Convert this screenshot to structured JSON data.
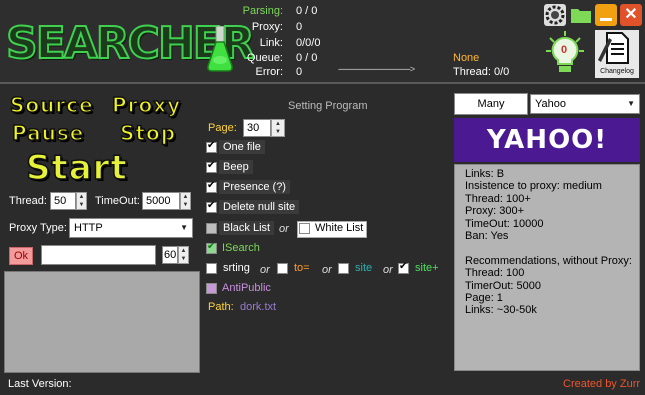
{
  "app": {
    "logo_text": "SEARCHER"
  },
  "status": {
    "parsing": {
      "label": "Parsing:",
      "value": "0 / 0"
    },
    "proxy": {
      "label": "Proxy:",
      "value": "0"
    },
    "link": {
      "label": "Link:",
      "value": "0/0/0"
    },
    "queue": {
      "label": "Queue:",
      "value": "0 / 0"
    },
    "error": {
      "label": "Error:",
      "value": "0"
    },
    "arrow": "------------------------------------>",
    "current": "None",
    "thread_label": "Thread:",
    "thread_value": "0/0"
  },
  "top_buttons": {
    "bulb_count": "0",
    "changelog_label": "Changelog"
  },
  "actions": {
    "source": "Source",
    "proxy": "Proxy",
    "pause": "Pause",
    "stop": "Stop",
    "start": "Start"
  },
  "left_settings": {
    "thread_label": "Thread:",
    "thread_value": "50",
    "timeout_label": "TimeOut:",
    "timeout_value": "5000",
    "proxy_type_label": "Proxy Type:",
    "proxy_type_value": "HTTP",
    "ok_label": "Ok",
    "proxy_text_value": "",
    "proxy_count_value": "60"
  },
  "middle": {
    "title": "Setting Program",
    "page_label": "Page:",
    "page_value": "30",
    "options": {
      "one_file": "One file",
      "beep": "Beep",
      "presence": "Presence (?)",
      "delete_null": "Delete null site",
      "black_list": "Black List",
      "or": "or",
      "white_list": "White List",
      "isearch": "ISearch",
      "srting": "srting",
      "to_eq": "to=",
      "site": "site",
      "site_plus": "site+",
      "antipublic": "AntiPublic"
    },
    "path_label": "Path:",
    "path_value": "dork.txt"
  },
  "right": {
    "many_tab": "Many",
    "engine_value": "Yahoo",
    "banner": "YAHOO!",
    "info_lines": [
      "Links: B",
      "Insistence to proxy: medium",
      "Thread: 100+",
      "Proxy: 300+",
      "TimeOut: 10000",
      "Ban: Yes",
      "",
      "Recommendations, without Proxy:",
      "Thread: 100",
      "TimerOut: 5000",
      "Page: 1",
      "Links: ~30-50k"
    ]
  },
  "footer": {
    "last_version": "Last Version:",
    "created_by": "Created by Zurr"
  },
  "colors": {
    "background": "#2b2b2b",
    "accent_yellow": "#f0f22a",
    "status_green": "#7bd957",
    "yahoo_purple": "#4b1a93",
    "created_by": "#f0542a"
  }
}
